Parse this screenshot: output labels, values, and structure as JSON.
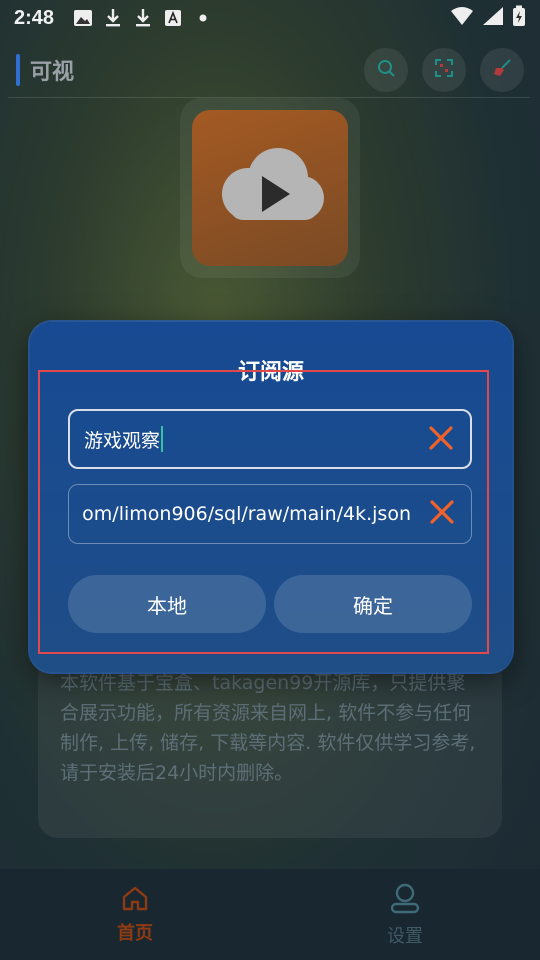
{
  "status_bar": {
    "time": "2:48",
    "icons": [
      "image-icon",
      "download-icon",
      "download-icon",
      "font-icon",
      "dot-icon"
    ],
    "right_icons": [
      "wifi-icon",
      "signal-icon",
      "battery-charging-icon"
    ]
  },
  "topbar": {
    "title": "可视",
    "actions": [
      "search-icon",
      "scan-icon",
      "clean-icon"
    ]
  },
  "description": "本软件基于宝盒、takagen99开源库，只提供聚合展示功能，所有资源来自网上, 软件不参与任何制作, 上传, 储存, 下载等内容. 软件仅供学习参考, 请于安装后24小时内删除。",
  "dialog": {
    "title": "订阅源",
    "name_field": {
      "value": "游戏观察"
    },
    "url_field": {
      "value": "om/limon906/sql/raw/main/4k.json"
    },
    "local_button": "本地",
    "confirm_button": "确定"
  },
  "bottom_nav": {
    "items": [
      {
        "label": "首页",
        "icon": "home-icon",
        "active": true
      },
      {
        "label": "设置",
        "icon": "user-icon",
        "active": false
      }
    ]
  },
  "colors": {
    "accent_blue": "#2f6fd1",
    "dialog_bg": "#174a93",
    "clear_orange": "#f0622a",
    "home_active": "#8e3a12",
    "highlight_red": "#e0484c"
  }
}
